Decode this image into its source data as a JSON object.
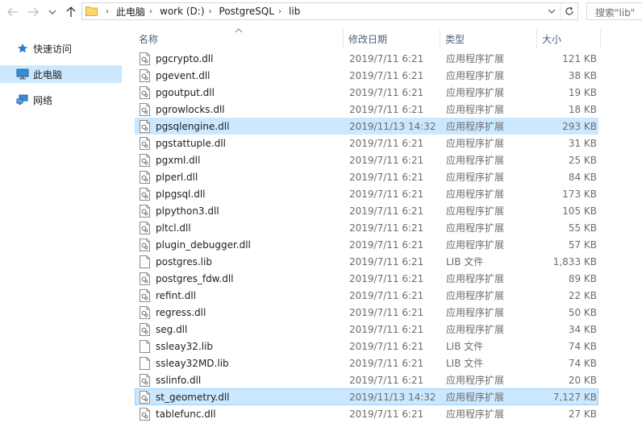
{
  "address": {
    "crumbs": [
      "此电脑",
      "work (D:)",
      "PostgreSQL",
      "lib"
    ]
  },
  "search": {
    "placeholder": "搜索\"lib\""
  },
  "nav": {
    "items": [
      {
        "label": "快速访问",
        "icon": "star-icon",
        "selected": false
      },
      {
        "label": "此电脑",
        "icon": "computer-icon",
        "selected": true
      },
      {
        "label": "网络",
        "icon": "network-icon",
        "selected": false
      }
    ]
  },
  "columns": {
    "name": "名称",
    "date": "修改日期",
    "type": "类型",
    "size": "大小"
  },
  "files": [
    {
      "name": "pgcrypto.dll",
      "date": "2019/7/11 6:21",
      "type": "应用程序扩展",
      "size": "121 KB",
      "kind": "dll"
    },
    {
      "name": "pgevent.dll",
      "date": "2019/7/11 6:21",
      "type": "应用程序扩展",
      "size": "38 KB",
      "kind": "dll"
    },
    {
      "name": "pgoutput.dll",
      "date": "2019/7/11 6:21",
      "type": "应用程序扩展",
      "size": "19 KB",
      "kind": "dll"
    },
    {
      "name": "pgrowlocks.dll",
      "date": "2019/7/11 6:21",
      "type": "应用程序扩展",
      "size": "18 KB",
      "kind": "dll"
    },
    {
      "name": "pgsqlengine.dll",
      "date": "2019/11/13 14:32",
      "type": "应用程序扩展",
      "size": "293 KB",
      "kind": "dll",
      "highlight": true
    },
    {
      "name": "pgstattuple.dll",
      "date": "2019/7/11 6:21",
      "type": "应用程序扩展",
      "size": "31 KB",
      "kind": "dll"
    },
    {
      "name": "pgxml.dll",
      "date": "2019/7/11 6:21",
      "type": "应用程序扩展",
      "size": "25 KB",
      "kind": "dll"
    },
    {
      "name": "plperl.dll",
      "date": "2019/7/11 6:21",
      "type": "应用程序扩展",
      "size": "84 KB",
      "kind": "dll"
    },
    {
      "name": "plpgsql.dll",
      "date": "2019/7/11 6:21",
      "type": "应用程序扩展",
      "size": "173 KB",
      "kind": "dll"
    },
    {
      "name": "plpython3.dll",
      "date": "2019/7/11 6:21",
      "type": "应用程序扩展",
      "size": "105 KB",
      "kind": "dll"
    },
    {
      "name": "pltcl.dll",
      "date": "2019/7/11 6:21",
      "type": "应用程序扩展",
      "size": "55 KB",
      "kind": "dll"
    },
    {
      "name": "plugin_debugger.dll",
      "date": "2019/7/11 6:21",
      "type": "应用程序扩展",
      "size": "57 KB",
      "kind": "dll"
    },
    {
      "name": "postgres.lib",
      "date": "2019/7/11 6:21",
      "type": "LIB 文件",
      "size": "1,833 KB",
      "kind": "file"
    },
    {
      "name": "postgres_fdw.dll",
      "date": "2019/7/11 6:21",
      "type": "应用程序扩展",
      "size": "89 KB",
      "kind": "dll"
    },
    {
      "name": "refint.dll",
      "date": "2019/7/11 6:21",
      "type": "应用程序扩展",
      "size": "22 KB",
      "kind": "dll"
    },
    {
      "name": "regress.dll",
      "date": "2019/7/11 6:21",
      "type": "应用程序扩展",
      "size": "50 KB",
      "kind": "dll"
    },
    {
      "name": "seg.dll",
      "date": "2019/7/11 6:21",
      "type": "应用程序扩展",
      "size": "34 KB",
      "kind": "dll"
    },
    {
      "name": "ssleay32.lib",
      "date": "2019/7/11 6:21",
      "type": "LIB 文件",
      "size": "74 KB",
      "kind": "file"
    },
    {
      "name": "ssleay32MD.lib",
      "date": "2019/7/11 6:21",
      "type": "LIB 文件",
      "size": "74 KB",
      "kind": "file"
    },
    {
      "name": "sslinfo.dll",
      "date": "2019/7/11 6:21",
      "type": "应用程序扩展",
      "size": "20 KB",
      "kind": "dll"
    },
    {
      "name": "st_geometry.dll",
      "date": "2019/11/13 14:32",
      "type": "应用程序扩展",
      "size": "7,127 KB",
      "kind": "dll",
      "highlight": true,
      "focused": true
    },
    {
      "name": "tablefunc.dll",
      "date": "2019/7/11 6:21",
      "type": "应用程序扩展",
      "size": "27 KB",
      "kind": "dll"
    }
  ],
  "colors": {
    "selection": "#cce8ff",
    "selection_border": "#99d1ff",
    "header_text": "#4c607a",
    "secondary_text": "#6d6d6d"
  }
}
